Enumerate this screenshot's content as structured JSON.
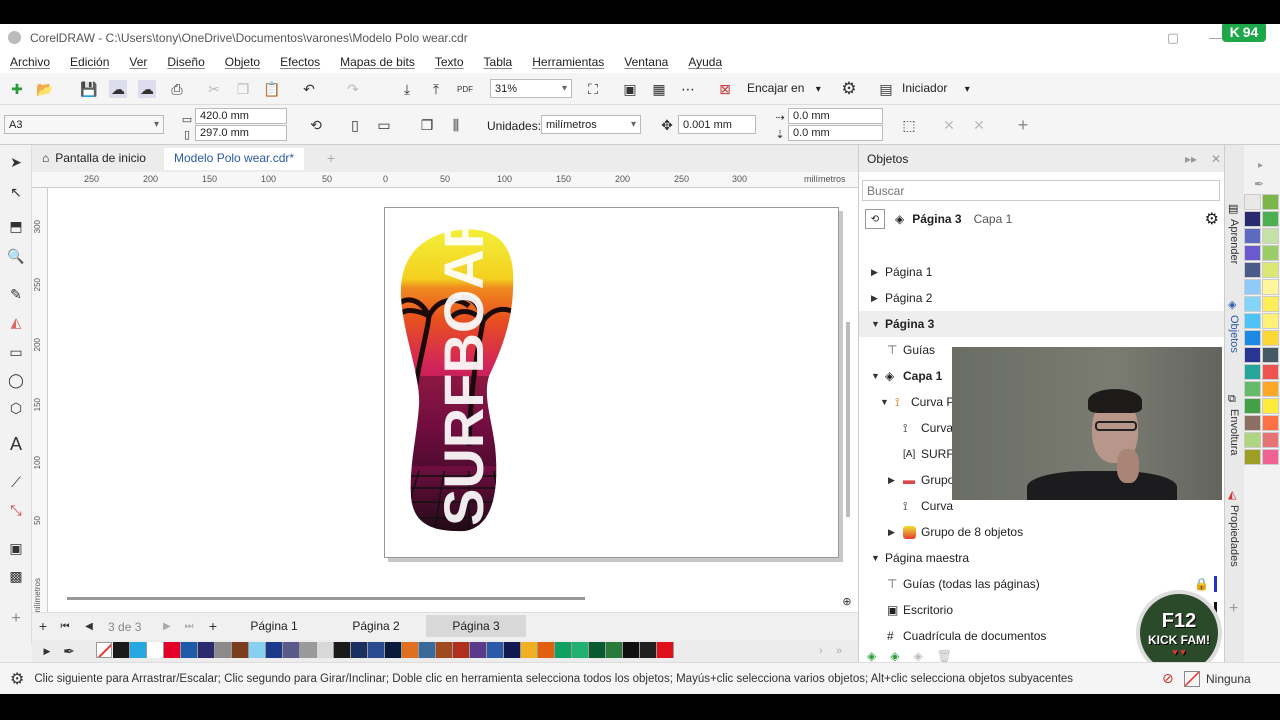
{
  "app": {
    "title": "CorelDRAW - C:\\Users\\tony\\OneDrive\\Documentos\\varones\\Modelo Polo wear.cdr",
    "badge": "94"
  },
  "menu": [
    "Archivo",
    "Edición",
    "Ver",
    "Diseño",
    "Objeto",
    "Efectos",
    "Mapas de bits",
    "Texto",
    "Tabla",
    "Herramientas",
    "Ventana",
    "Ayuda"
  ],
  "toolbar": {
    "zoom": "31%",
    "snap_label": "Encajar en",
    "workspace_label": "Iniciador"
  },
  "propbar": {
    "page_size": "A3",
    "width": "420.0 mm",
    "height": "297.0 mm",
    "units_label": "Unidades:",
    "units_value": "milímetros",
    "nudge": "0.001 mm",
    "dup_x": "0.0 mm",
    "dup_y": "0.0 mm"
  },
  "tabs": {
    "home": "Pantalla de inicio",
    "document": "Modelo Polo wear.cdr*"
  },
  "ruler": {
    "ticks": [
      "250",
      "200",
      "150",
      "100",
      "50",
      "0",
      "50",
      "100",
      "150",
      "200",
      "250",
      "300"
    ],
    "unit": "milímetros",
    "vticks": [
      "300",
      "250",
      "200",
      "150",
      "100",
      "50"
    ]
  },
  "artwork": {
    "text": "SURFBOARD"
  },
  "pages": {
    "counter": "3",
    "of": "de 3",
    "tabs": [
      "Página 1",
      "Página 2",
      "Página 3"
    ]
  },
  "objects_panel": {
    "title": "Objetos",
    "search_placeholder": "Buscar",
    "current_page": "Página 3",
    "current_layer": "Capa 1",
    "tree": [
      {
        "label": "Página 1"
      },
      {
        "label": "Página 2"
      },
      {
        "label": "Página 3"
      },
      {
        "label": "Guías"
      },
      {
        "label": "Capa 1"
      },
      {
        "label": "Curva P"
      },
      {
        "label": "Curva"
      },
      {
        "label": "SURFE"
      },
      {
        "label": "Grupo"
      },
      {
        "label": "Curva"
      },
      {
        "label": "Grupo de 8 objetos"
      },
      {
        "label": "Página maestra"
      },
      {
        "label": "Guías (todas las páginas)"
      },
      {
        "label": "Escritorio"
      },
      {
        "label": "Cuadrícula de documentos"
      }
    ]
  },
  "docker_tabs": [
    "Aprender",
    "Objetos",
    "Envoltura",
    "Propiedades"
  ],
  "status": {
    "hint": "Clic siguiente para Arrastrar/Escalar; Clic segundo para Girar/Inclinar; Doble clic en herramienta selecciona todos los objetos; Mayús+clic selecciona varios objetos; Alt+clic selecciona objetos subyacentes",
    "fill": "Ninguna"
  },
  "watermark": {
    "line1": "F12",
    "line2": "KICK FAM!"
  },
  "palette": [
    "#1a1a1a",
    "#27a7e0",
    "#ffffff",
    "#e4002b",
    "#1e5aa8",
    "#2a2a6e",
    "#8a8a8a",
    "#7a3d1d",
    "#88d0f0",
    "#1b3a8c",
    "#5a5a8a",
    "#9a9a9a",
    "#d8d8d8",
    "#1a1a1a",
    "#1a3060",
    "#2a4a90",
    "#0a1a3a",
    "#e07020",
    "#3a6a9a",
    "#a04a20",
    "#b03020",
    "#5a3a8a",
    "#2a5aa8",
    "#101a50",
    "#f0b020",
    "#e06010",
    "#10a060",
    "#20b070",
    "#0a5a30",
    "#2a7a3a",
    "#101010",
    "#202020",
    "#e0101a"
  ],
  "right_palette": [
    "#e8e8e8",
    "#7ab648",
    "#2a2a6e",
    "#4caf50",
    "#5c6bc0",
    "#c5e1a5",
    "#6a5acd",
    "#9ccc65",
    "#4a5a8a",
    "#dce775",
    "#90caf9",
    "#fff59d",
    "#81d4fa",
    "#ffee58",
    "#4fc3f7",
    "#fff176",
    "#1e88e5",
    "#fdd835",
    "#283593",
    "#455a64",
    "#26a69a",
    "#ef5350",
    "#66bb6a",
    "#ffa726",
    "#43a047",
    "#ffeb3b",
    "#8d6e63",
    "#ff7043",
    "#aed581",
    "#e57373",
    "#9e9d24",
    "#f06292"
  ]
}
